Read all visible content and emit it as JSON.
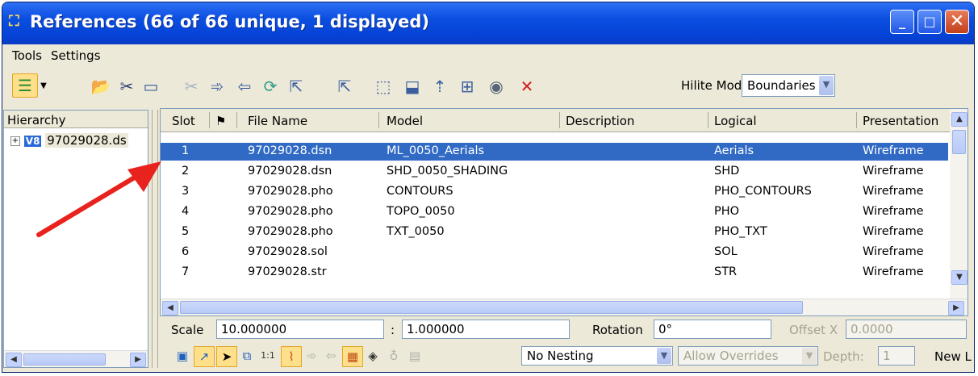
{
  "window": {
    "title": "References (66 of 66 unique, 1 displayed)",
    "minimize": "_",
    "maximize": "□",
    "close": "✕"
  },
  "menu": {
    "tools": "Tools",
    "settings": "Settings"
  },
  "toolbar": {
    "hilite_label": "Hilite Mode:",
    "hilite_value": "Boundaries"
  },
  "hierarchy": {
    "header": "Hierarchy",
    "item": "97029028.ds"
  },
  "table": {
    "columns": [
      "Slot",
      "File Name",
      "Model",
      "Description",
      "Logical",
      "Presentation"
    ],
    "rows": [
      {
        "slot": "1",
        "file": "97029028.dsn",
        "model": "ML_0050_Aerials",
        "description": "",
        "logical": "Aerials",
        "presentation": "Wireframe"
      },
      {
        "slot": "2",
        "file": "97029028.dsn",
        "model": "SHD_0050_SHADING",
        "description": "",
        "logical": "SHD",
        "presentation": "Wireframe"
      },
      {
        "slot": "3",
        "file": "97029028.pho",
        "model": "CONTOURS",
        "description": "",
        "logical": "PHO_CONTOURS",
        "presentation": "Wireframe"
      },
      {
        "slot": "4",
        "file": "97029028.pho",
        "model": "TOPO_0050",
        "description": "",
        "logical": "PHO",
        "presentation": "Wireframe"
      },
      {
        "slot": "5",
        "file": "97029028.pho",
        "model": "TXT_0050",
        "description": "",
        "logical": "PHO_TXT",
        "presentation": "Wireframe"
      },
      {
        "slot": "6",
        "file": "97029028.sol",
        "model": "",
        "description": "",
        "logical": "SOL",
        "presentation": "Wireframe"
      },
      {
        "slot": "7",
        "file": "97029028.str",
        "model": "",
        "description": "",
        "logical": "STR",
        "presentation": "Wireframe"
      }
    ]
  },
  "settings": {
    "scale_label": "Scale",
    "scale_value": "10.000000",
    "ratio_sep": ":",
    "scale_value2": "1.000000",
    "rotation_label": "Rotation",
    "rotation_value": "0°",
    "offset_label": "Offset X",
    "offset_value": "0.0000",
    "nesting_value": "No Nesting",
    "overrides_value": "Allow Overrides",
    "depth_label": "Depth:",
    "depth_value": "1",
    "new_label": "New L"
  },
  "colors": {
    "selection": "#316ac5",
    "titlebar": "#0a4ee0",
    "arrow": "#e8231e"
  }
}
